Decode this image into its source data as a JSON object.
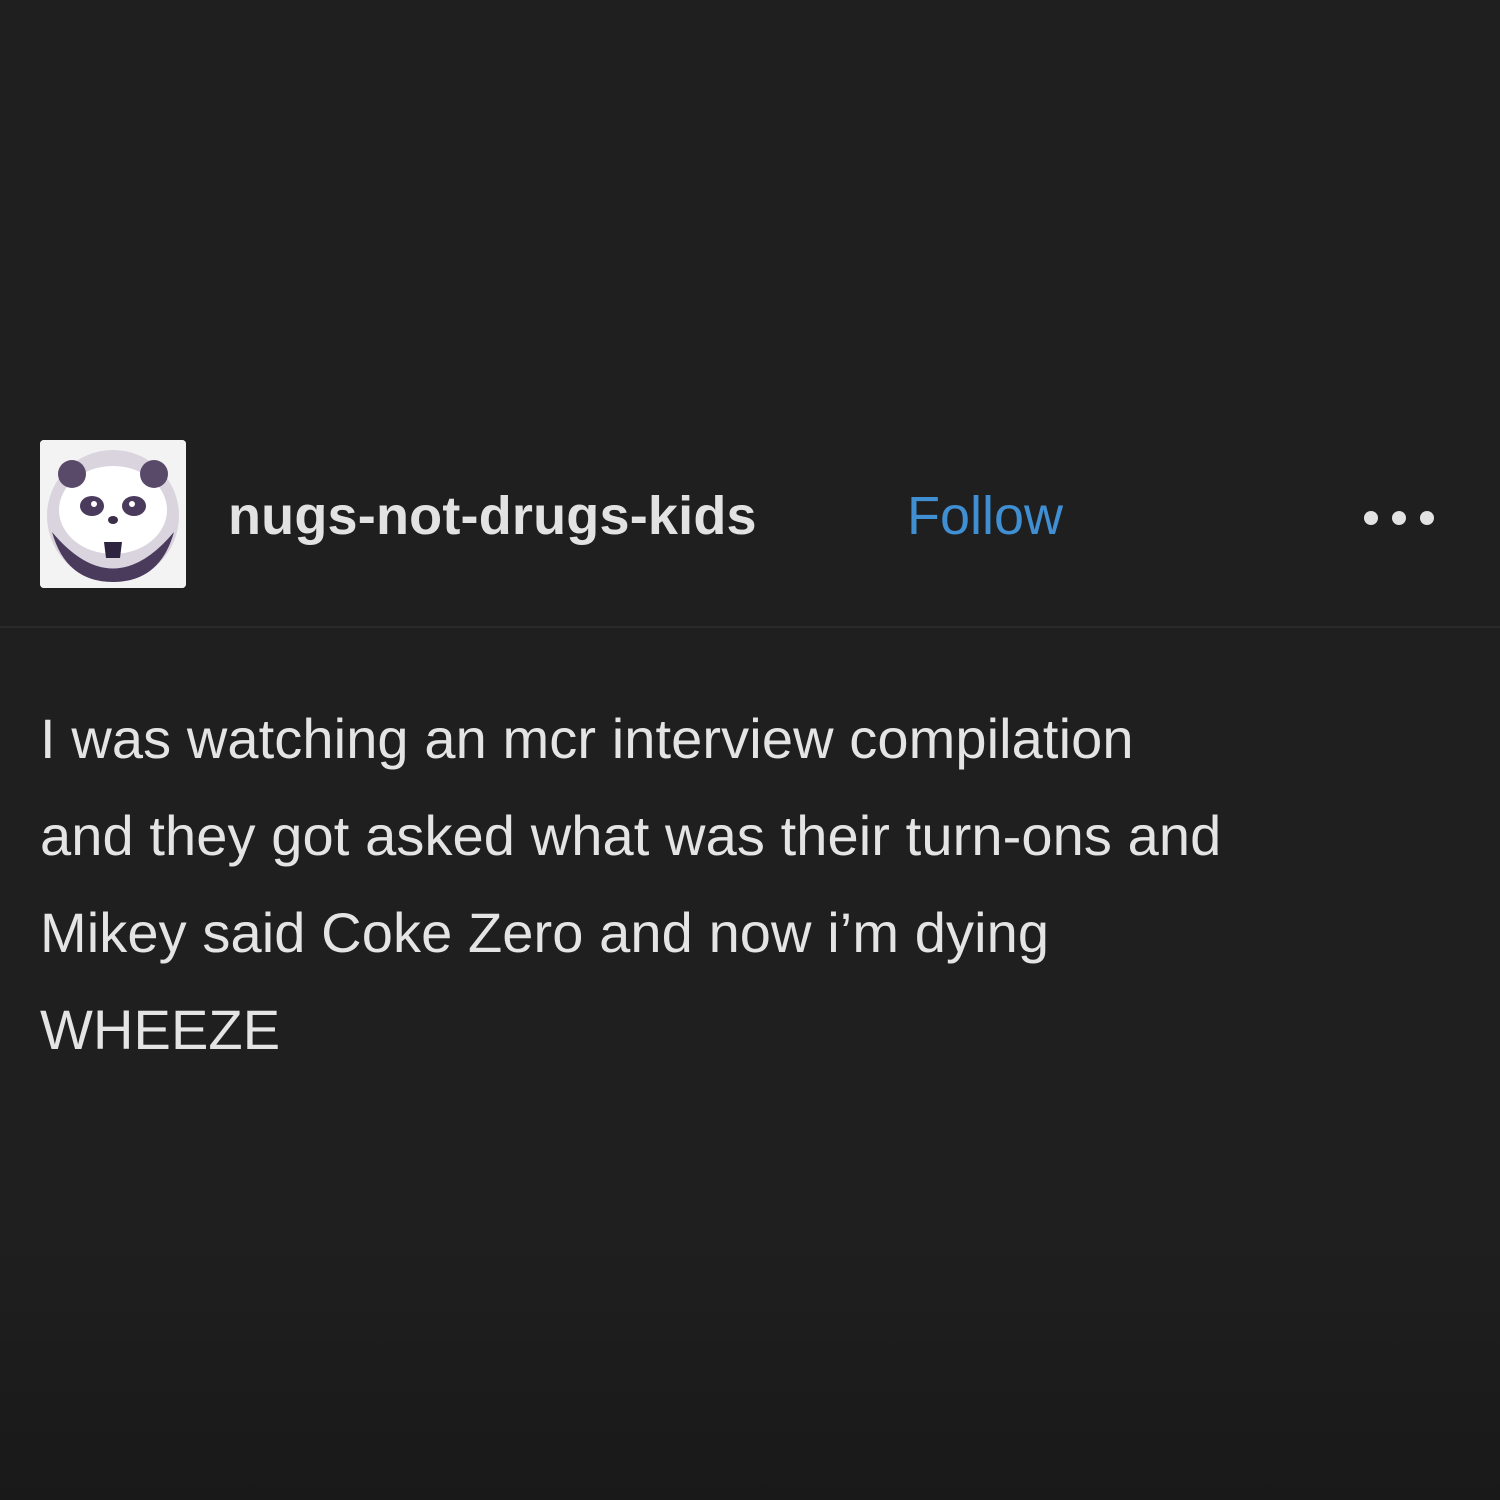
{
  "post": {
    "username": "nugs-not-drugs-kids",
    "follow_label": "Follow",
    "more_icon": "ellipsis-icon",
    "avatar_icon": "panda-avatar",
    "body_lines": [
      "I was watching an mcr interview compilation",
      "and they got asked what was their turn-ons and",
      "Mikey said Coke Zero and now i’m dying",
      "WHEEZE"
    ]
  },
  "colors": {
    "background": "#1f1f1f",
    "text": "#e4e4e4",
    "follow_link": "#3f8fd2"
  }
}
